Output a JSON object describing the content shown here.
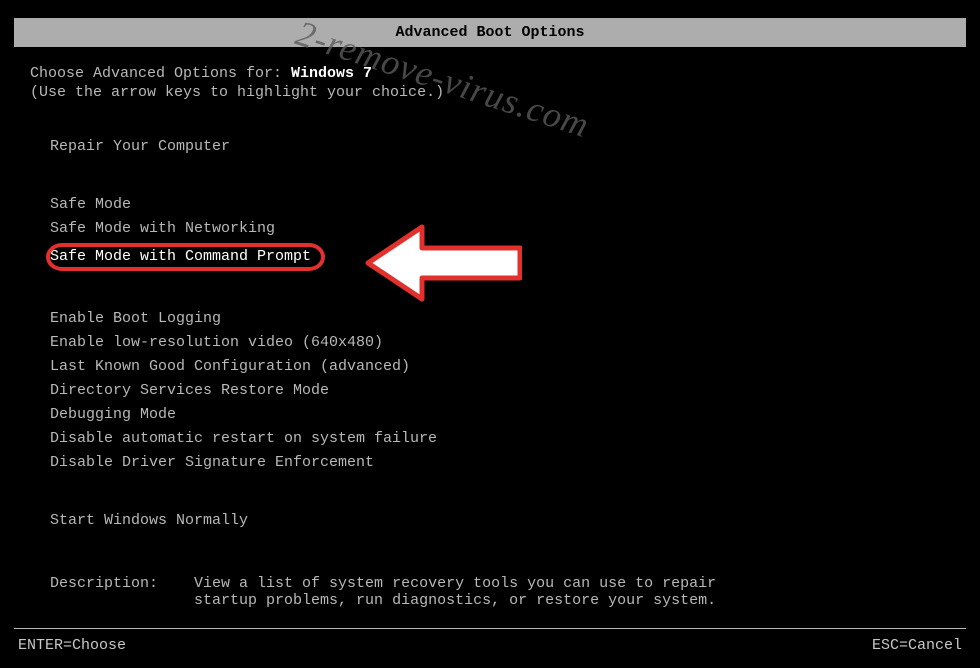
{
  "title": "Advanced Boot Options",
  "choose_label": "Choose Advanced Options for: ",
  "os_name": "Windows 7",
  "hint": "(Use the arrow keys to highlight your choice.)",
  "repair": "Repair Your Computer",
  "items_a": [
    "Safe Mode",
    "Safe Mode with Networking",
    "Safe Mode with Command Prompt"
  ],
  "items_b": [
    "Enable Boot Logging",
    "Enable low-resolution video (640x480)",
    "Last Known Good Configuration (advanced)",
    "Directory Services Restore Mode",
    "Debugging Mode",
    "Disable automatic restart on system failure",
    "Disable Driver Signature Enforcement"
  ],
  "start_normal": "Start Windows Normally",
  "description_label": "Description:    ",
  "description_text": "View a list of system recovery tools you can use to repair\nstartup problems, run diagnostics, or restore your system.",
  "enter_label": "ENTER=Choose",
  "esc_label": "ESC=Cancel",
  "watermark": "2-remove-virus.com"
}
